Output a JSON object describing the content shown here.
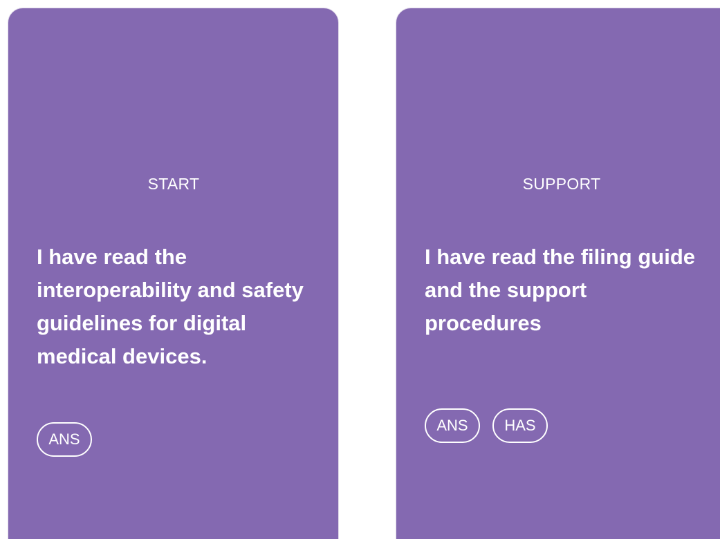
{
  "colors": {
    "card_background": "#8469b1",
    "card_border": "#e1dbea",
    "text": "#ffffff",
    "page_background": "#ffffff"
  },
  "cards": [
    {
      "category": "START",
      "statement": "I have read the interoperability and safety guidelines for digital medical devices.",
      "tags": [
        "ANS"
      ]
    },
    {
      "category": "SUPPORT",
      "statement": "I have read the filing guide and the support procedures",
      "tags": [
        "ANS",
        "HAS"
      ]
    }
  ]
}
